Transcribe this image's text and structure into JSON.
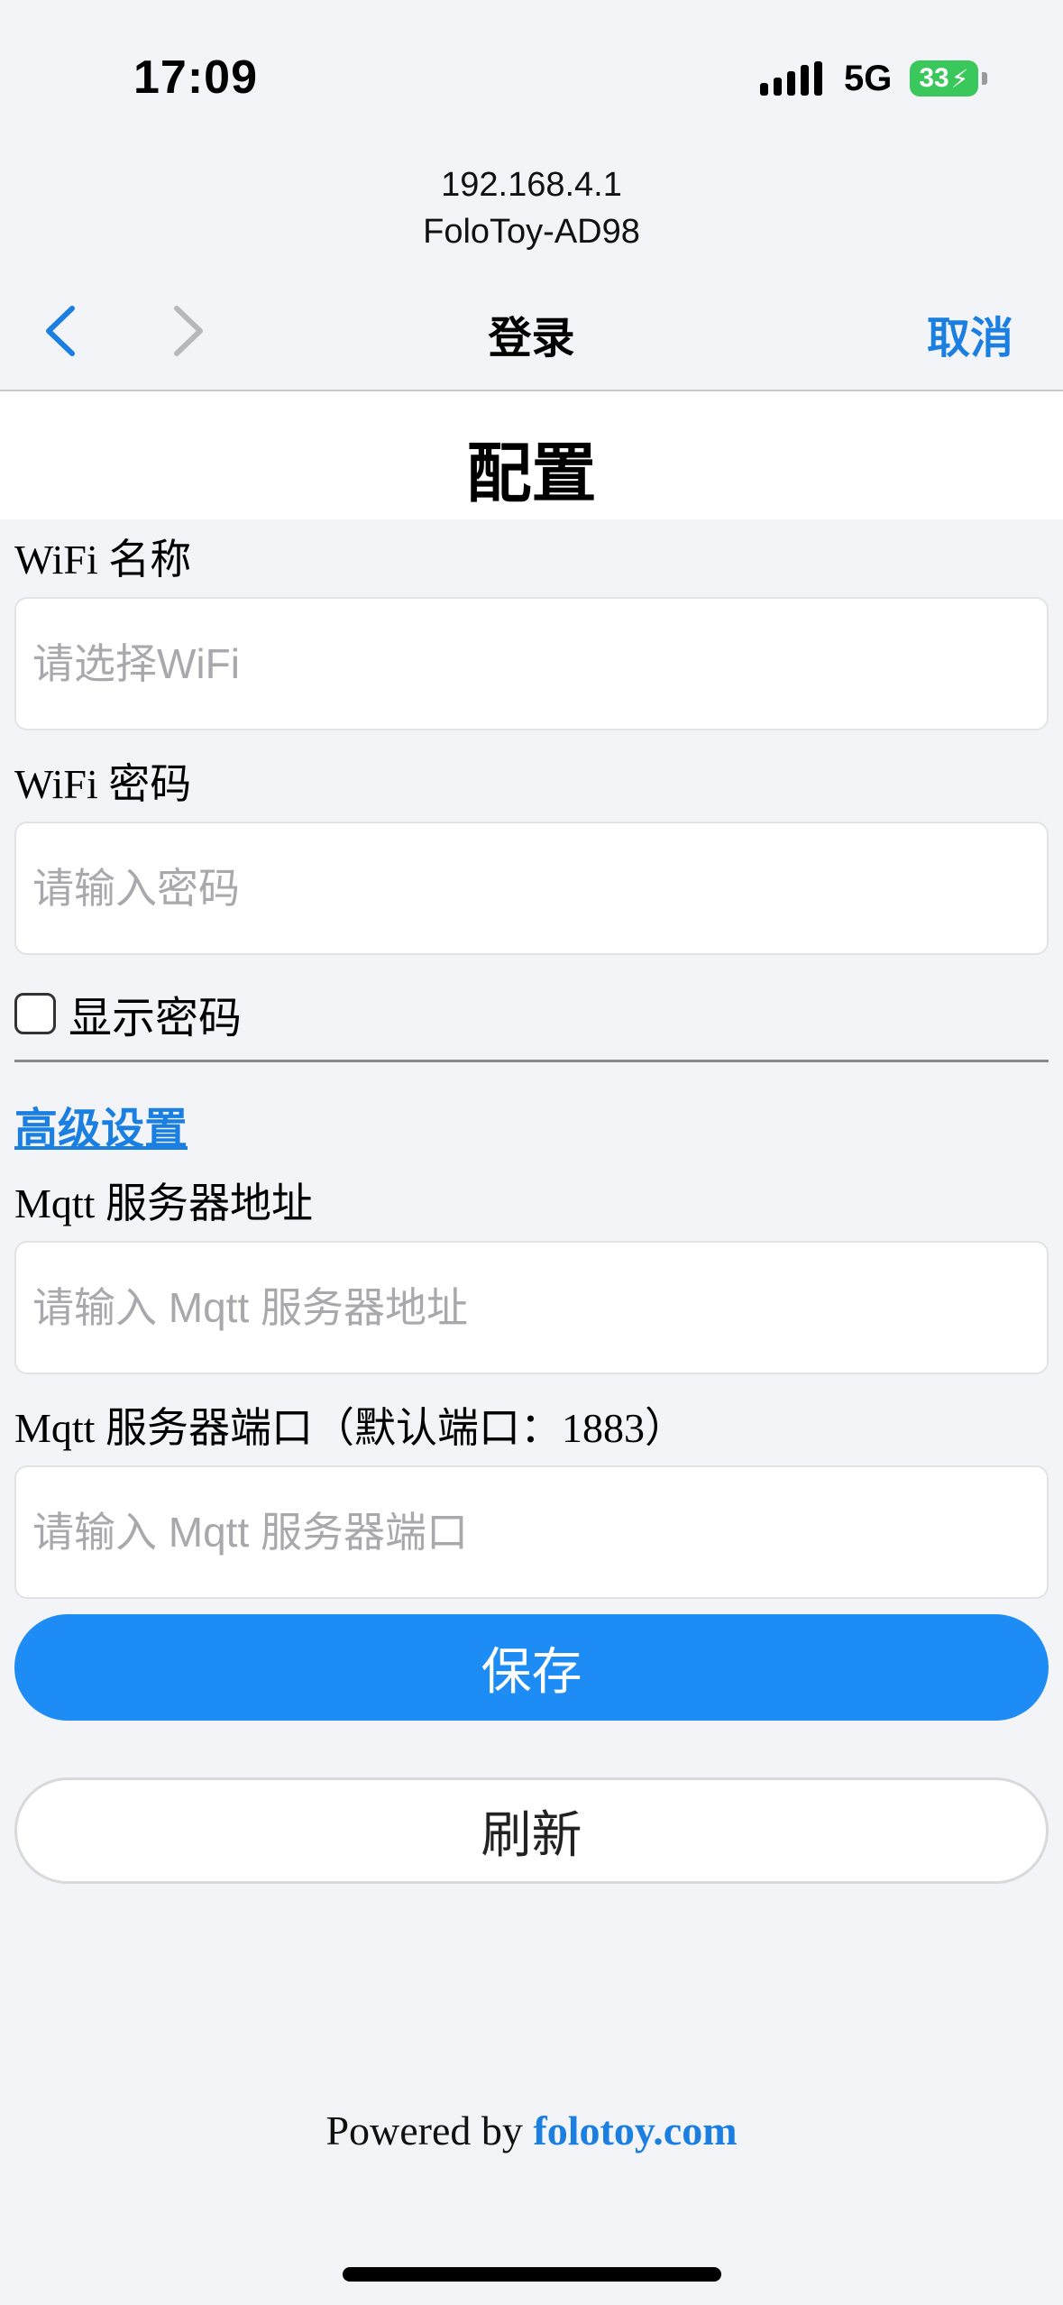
{
  "status_bar": {
    "time": "17:09",
    "network": "5G",
    "battery": "33"
  },
  "browser": {
    "url": "192.168.4.1",
    "site_name": "FoloToy-AD98",
    "title": "登录",
    "cancel_label": "取消"
  },
  "page": {
    "title": "配置",
    "wifi_name_label": "WiFi 名称",
    "wifi_name_placeholder": "请选择WiFi",
    "wifi_password_label": "WiFi 密码",
    "wifi_password_placeholder": "请输入密码",
    "show_password_label": "显示密码",
    "advanced_settings_link": "高级设置",
    "mqtt_address_label": "Mqtt 服务器地址",
    "mqtt_address_placeholder": "请输入 Mqtt 服务器地址",
    "mqtt_port_label": "Mqtt 服务器端口（默认端口：1883）",
    "mqtt_port_placeholder": "请输入 Mqtt 服务器端口",
    "save_label": "保存",
    "refresh_label": "刷新"
  },
  "footer": {
    "powered_by": "Powered by ",
    "link_text": "folotoy.com"
  },
  "colors": {
    "accent": "#1e8cf5",
    "link": "#1a7fe0",
    "battery": "#3ac75b"
  }
}
